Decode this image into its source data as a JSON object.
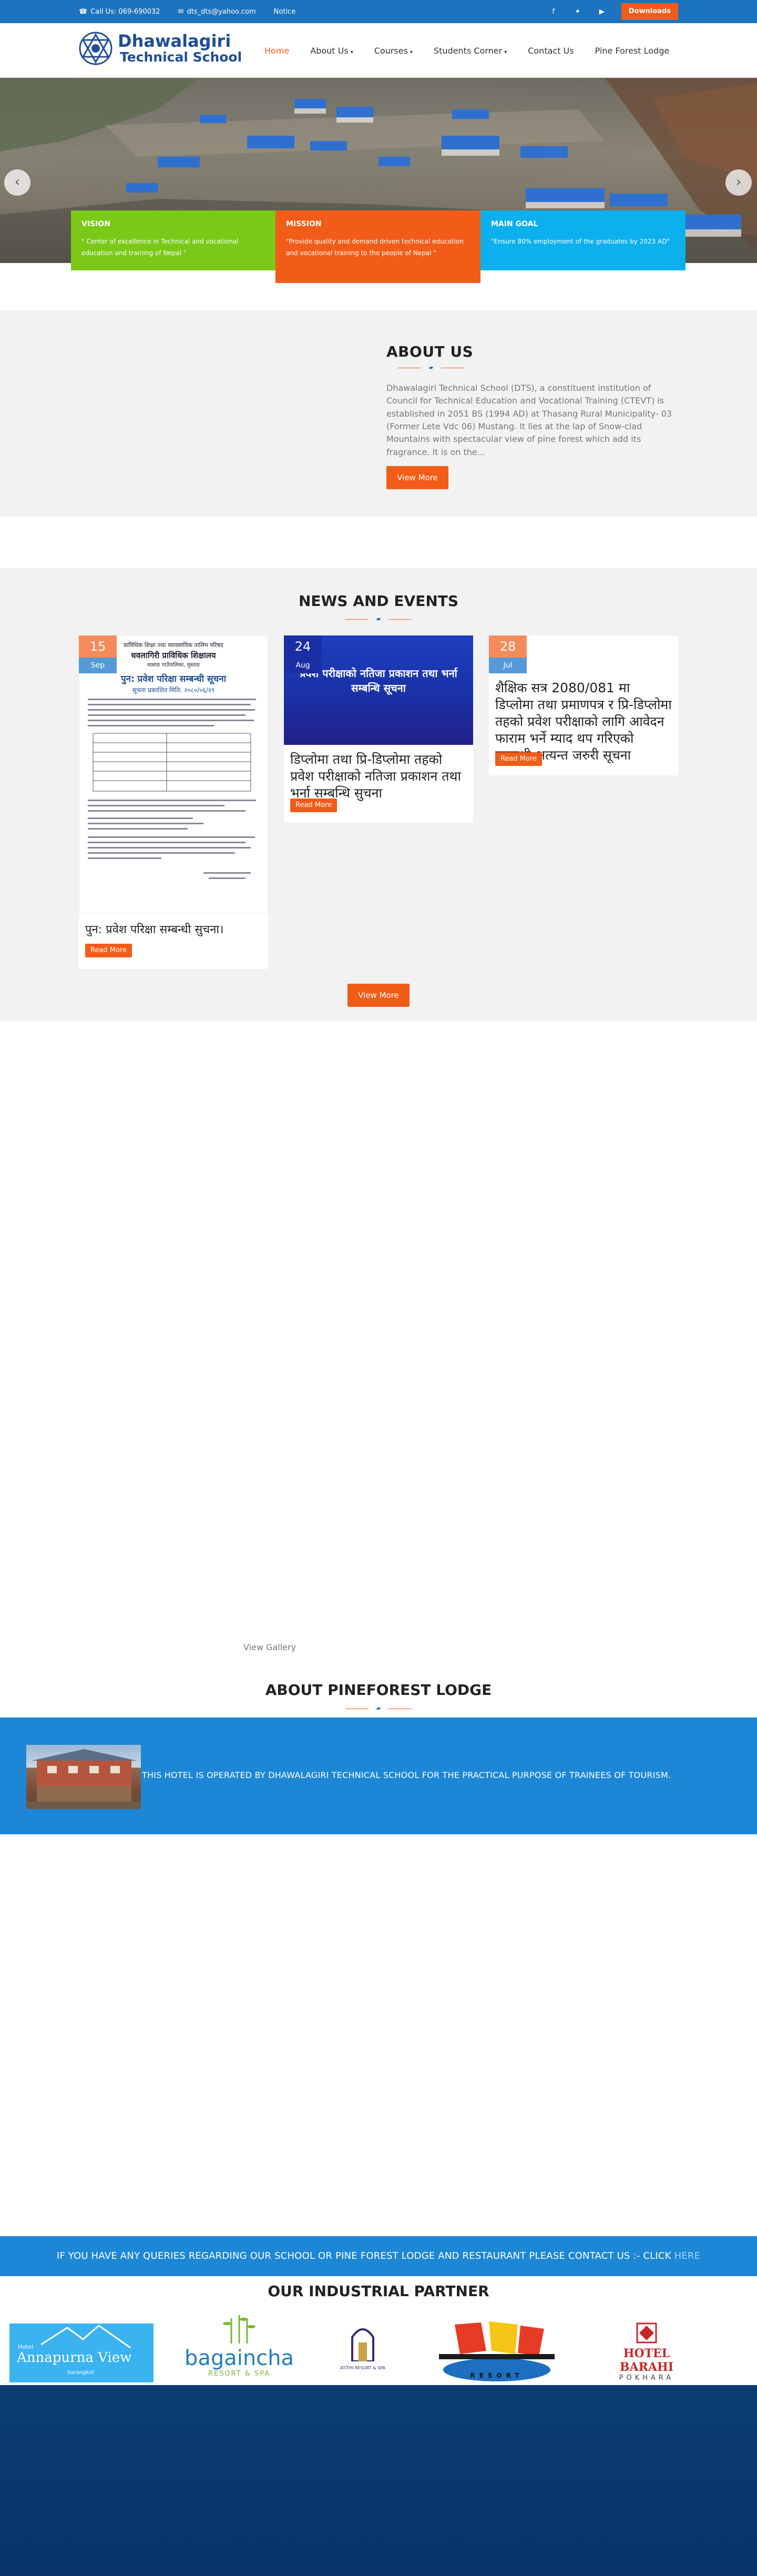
{
  "topbar": {
    "phone": "Call Us: 069-690032",
    "email": "dts_dts@yahoo.com",
    "notice": "Notice",
    "downloads": "Downloads",
    "social": [
      "facebook-icon",
      "twitter-icon",
      "youtube-icon"
    ]
  },
  "logo": {
    "line1": "Dhawalagiri",
    "line2": "Technical School"
  },
  "menu": [
    {
      "label": "Home",
      "active": true,
      "dropdown": false
    },
    {
      "label": "About Us",
      "active": false,
      "dropdown": true
    },
    {
      "label": "Courses",
      "active": false,
      "dropdown": true
    },
    {
      "label": "Students Corner",
      "active": false,
      "dropdown": true
    },
    {
      "label": "Contact Us",
      "active": false,
      "dropdown": false
    },
    {
      "label": "Pine Forest Lodge",
      "active": false,
      "dropdown": false
    }
  ],
  "hero": {
    "prev": "‹",
    "next": "›"
  },
  "cards": {
    "vision": {
      "title": "VISION",
      "text": "\" Center of excellence in Technical and vocational education and training of Nepal \""
    },
    "mission": {
      "title": "MISSION",
      "text": "\"Provide quality and demand driven technical education and vocational training to the people of Nepal \""
    },
    "goal": {
      "title": "MAIN GOAL",
      "text": "\"Ensure 80% employment of the graduates by 2023 AD\""
    }
  },
  "about": {
    "title": "ABOUT US",
    "text": "Dhawalagiri Technical School (DTS), a constituent institution of Council for Technical Education and Vocational Training (CTEVT) is established in 2051 BS (1994 AD) at Thasang Rural Municipality- 03 (Former Lete Vdc 06) Mustang. It lies at the lap of Snow-clad Mountains with spectacular view of pine forest which add its fragrance. It is on the...",
    "button": "View More"
  },
  "news": {
    "title": "NEWS AND EVENTS",
    "read_more": "Read More",
    "view_more": "View More",
    "items": [
      {
        "day": "15",
        "month": "Sep",
        "title": "पुन: प्रवेश परिक्षा सम्बन्धी सुचना।",
        "notice": {
          "org": "प्राविधिक शिक्षा तथा व्यावसायिक तालिम परिषद",
          "school": "धवलागिरी प्राविधिक शिक्षालय",
          "place": "थासाङ गाउँपालिका, मुस्ताङ",
          "heading": "पुन: प्रवेश परिक्षा सम्बन्धी सूचना",
          "date": "सूचना प्रकाशित मिति: २०८०/०६/२९"
        }
      },
      {
        "day": "24",
        "month": "Aug",
        "banner": "प्रवेश परीक्षाको नतिजा प्रकाशन तथा भर्ना सम्बन्धि सूचना",
        "title": "डिप्लोमा तथा प्रि-डिप्लोमा तहको प्रवेश परीक्षाको नतिजा प्रकाशन तथा भर्ना सम्बन्धि सुचना"
      },
      {
        "day": "28",
        "month": "Jul",
        "title": "शैक्षिक सत्र 2080/081 मा डिप्लोमा तथा प्रमाणपत्र र प्रि-डिप्लोमा तहको प्रवेश परीक्षाको लागि आवेदन फाराम भर्ने म्याद थप गरिएको सम्बन्धी अत्यन्त जरुरी सूचना"
      }
    ]
  },
  "gallery": {
    "link": "View Gallery"
  },
  "lodge": {
    "title": "ABOUT PINEFOREST LODGE",
    "text": "THIS HOTEL IS OPERATED BY DHAWALAGIRI TECHNICAL SCHOOL FOR THE PRACTICAL PURPOSE OF TRAINEES OF TOURISM."
  },
  "contact": {
    "text": "IF YOU HAVE ANY QUERIES REGARDING OUR SCHOOL OR PINE FOREST LODGE AND RESTAURANT PLEASE CONTACT US :- CLICK",
    "link": "HERE"
  },
  "partners": {
    "title": "OUR INDUSTRIAL PARTNER",
    "logos": [
      {
        "name": "Annapurna View",
        "prefix": "Hotel",
        "sub": "Sarangkot"
      },
      {
        "name": "bagaincha",
        "sub": "RESORT & SPA"
      },
      {
        "name": "ATITHI RESORT & SPA"
      },
      {
        "name": "RESORT"
      },
      {
        "name": "HOTEL BARAHI",
        "sub": "POKHARA"
      }
    ]
  },
  "colors": {
    "brand_blue": "#1e73be",
    "accent_orange": "#f25c19",
    "vision_green": "#7ac919",
    "goal_cyan": "#0bb0ec",
    "band_blue": "#1d87d5",
    "footer_navy": "#0b3d73"
  }
}
